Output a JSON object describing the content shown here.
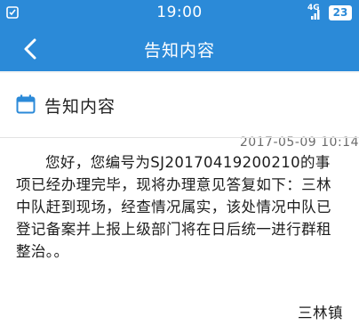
{
  "status_bar": {
    "time": "19:00",
    "signal_label": "4G",
    "battery_level": "23",
    "accent_color": "#2b8ad8"
  },
  "nav_bar": {
    "back_icon": "chevron-left-icon",
    "title": "告知内容"
  },
  "notice": {
    "header_icon": "calendar-icon",
    "title": "告知内容",
    "datetime": "2017-05-09 10:14",
    "body": "您好，您编号为SJ20170419200210的事项已经办理完毕，现将办理意见答复如下：三林中队赶到现场，经查情况属实，该处情况中队已登记备案并上报上级部门将在日后统一进行群租整治。。",
    "signature": "三林镇"
  }
}
